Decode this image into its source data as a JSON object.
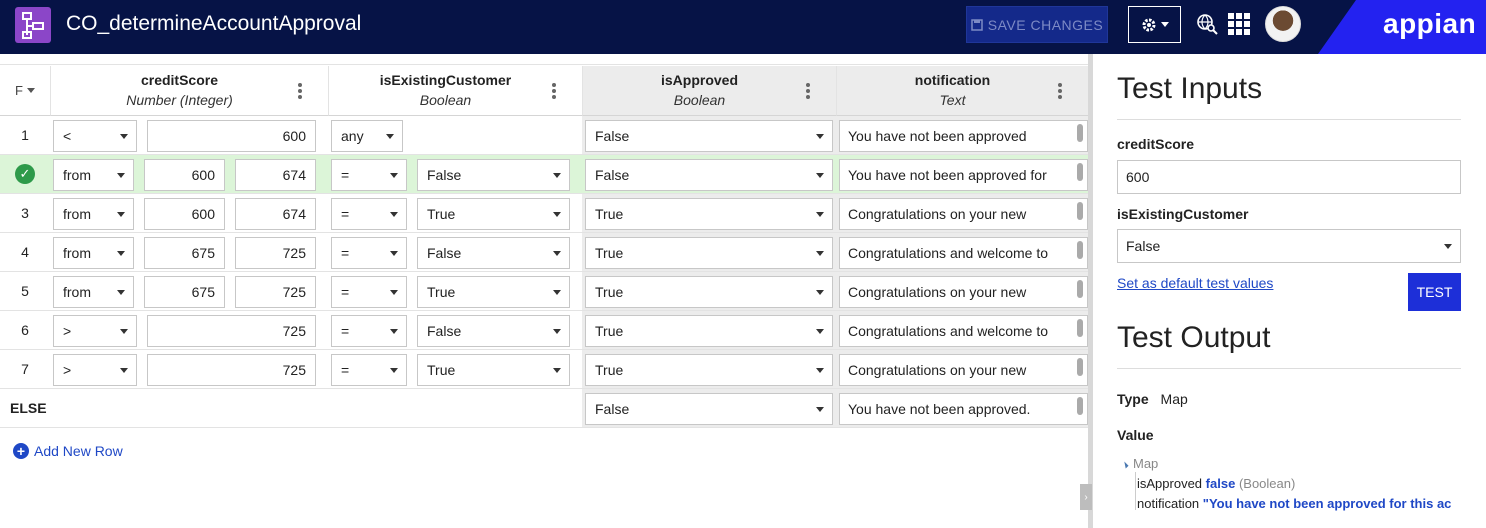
{
  "header": {
    "title": "CO_determineAccountApproval",
    "save_label": "SAVE CHANGES",
    "brand": "appian"
  },
  "table": {
    "first_col_label": "F",
    "columns": [
      {
        "name": "creditScore",
        "type": "Number (Integer)"
      },
      {
        "name": "isExistingCustomer",
        "type": "Boolean"
      },
      {
        "name": "isApproved",
        "type": "Boolean"
      },
      {
        "name": "notification",
        "type": "Text"
      }
    ],
    "rows": [
      {
        "num": "1",
        "op": "<",
        "v1": "600",
        "v2": "",
        "bop": "any",
        "bval": "",
        "approved": "False",
        "note": "You have not been approved",
        "active": false
      },
      {
        "num": "",
        "op": "from",
        "v1": "600",
        "v2": "674",
        "bop": "=",
        "bval": "False",
        "approved": "False",
        "note": "You have not been approved for",
        "active": true
      },
      {
        "num": "3",
        "op": "from",
        "v1": "600",
        "v2": "674",
        "bop": "=",
        "bval": "True",
        "approved": "True",
        "note": "Congratulations on your new",
        "active": false
      },
      {
        "num": "4",
        "op": "from",
        "v1": "675",
        "v2": "725",
        "bop": "=",
        "bval": "False",
        "approved": "True",
        "note": "Congratulations and welcome to",
        "active": false
      },
      {
        "num": "5",
        "op": "from",
        "v1": "675",
        "v2": "725",
        "bop": "=",
        "bval": "True",
        "approved": "True",
        "note": "Congratulations on your new",
        "active": false
      },
      {
        "num": "6",
        "op": ">",
        "v1": "725",
        "v2": "",
        "bop": "=",
        "bval": "False",
        "approved": "True",
        "note": "Congratulations and welcome to",
        "active": false
      },
      {
        "num": "7",
        "op": ">",
        "v1": "725",
        "v2": "",
        "bop": "=",
        "bval": "True",
        "approved": "True",
        "note": "Congratulations on your new",
        "active": false
      }
    ],
    "else_row": {
      "label": "ELSE",
      "approved": "False",
      "note": "You have not been approved."
    },
    "add_row_label": "Add New Row"
  },
  "panel": {
    "inputs_title": "Test Inputs",
    "credit_label": "creditScore",
    "credit_value": "600",
    "existing_label": "isExistingCustomer",
    "existing_value": "False",
    "default_link": "Set as default test values",
    "test_button": "TEST",
    "output_title": "Test Output",
    "type_label": "Type",
    "type_value": "Map",
    "value_label": "Value",
    "tree": {
      "root": "Map",
      "k1": "isApproved",
      "v1": "false",
      "t1": "(Boolean)",
      "k2": "notification",
      "v2": "\"You have not been approved for this ac"
    }
  },
  "colors": {
    "header_bg": "#061346",
    "brand_bg": "#2322f0",
    "link": "#1f48c6",
    "active_row": "#dcf5d8"
  }
}
